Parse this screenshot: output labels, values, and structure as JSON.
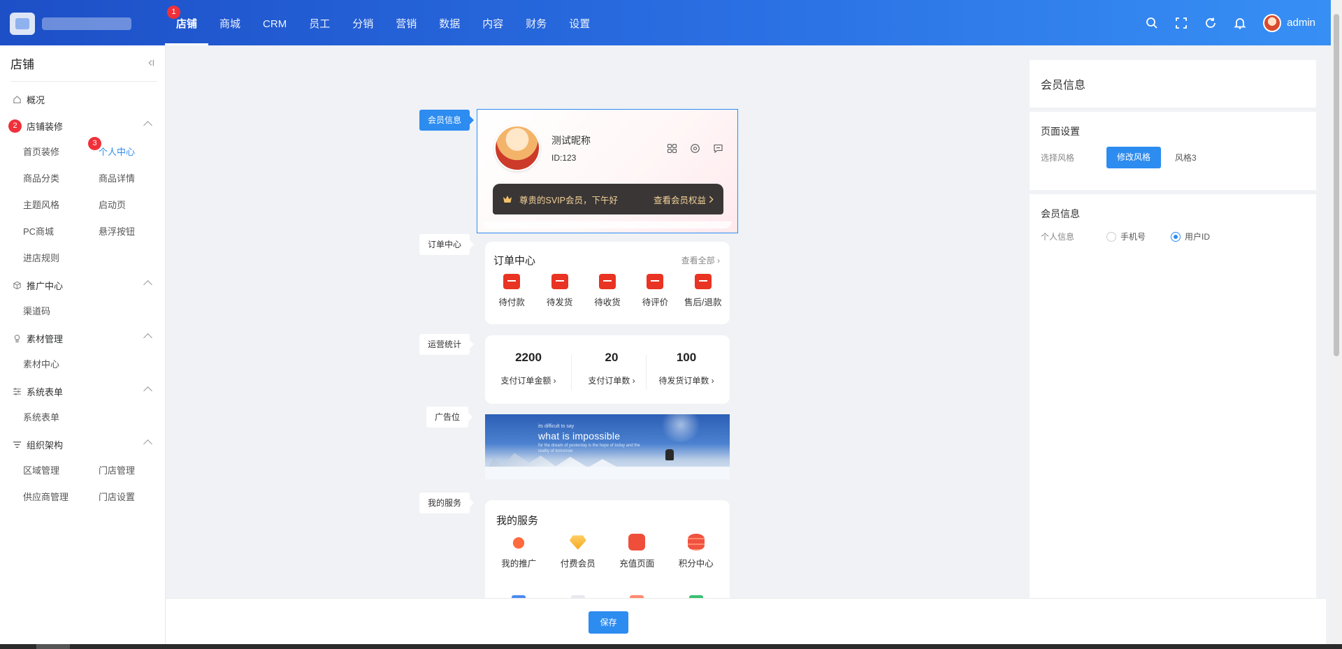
{
  "topbar": {
    "nav": [
      "店铺",
      "商城",
      "CRM",
      "员工",
      "分销",
      "营销",
      "数据",
      "内容",
      "财务",
      "设置"
    ],
    "active_index": 0,
    "badge": "1",
    "icons": [
      "search-icon",
      "fullscreen-icon",
      "refresh-icon",
      "bell-icon"
    ],
    "username": "admin"
  },
  "sidebar": {
    "title": "店铺",
    "overview": "概况",
    "groups": [
      {
        "label": "店铺装修",
        "badge": "2",
        "items": [
          "首页装修",
          "个人中心",
          "商品分类",
          "商品详情",
          "主题风格",
          "启动页",
          "PC商城",
          "悬浮按钮",
          "进店规则"
        ],
        "active_item": "个人中心",
        "active_badge": "3"
      },
      {
        "label": "推广中心",
        "items": [
          "渠道码"
        ]
      },
      {
        "label": "素材管理",
        "items": [
          "素材中心"
        ]
      },
      {
        "label": "系统表单",
        "items": [
          "系统表单"
        ]
      },
      {
        "label": "组织架构",
        "items": [
          "区域管理",
          "门店管理",
          "供应商管理",
          "门店设置"
        ]
      }
    ]
  },
  "preview": {
    "tags": [
      "会员信息",
      "订单中心",
      "运营统计",
      "广告位",
      "我的服务"
    ],
    "member": {
      "nickname": "测试昵称",
      "id": "ID:123",
      "vip_text": "尊贵的SVIP会员，下午好",
      "vip_link": "查看会员权益"
    },
    "order": {
      "title": "订单中心",
      "more": "查看全部",
      "items": [
        "待付款",
        "待发货",
        "待收货",
        "待评价",
        "售后/退款"
      ]
    },
    "stats": [
      {
        "value": "2200",
        "label": "支付订单金额"
      },
      {
        "value": "20",
        "label": "支付订单数"
      },
      {
        "value": "100",
        "label": "待发货订单数"
      }
    ],
    "banner": {
      "small": "its difficult to say",
      "big": "what is impossible",
      "sub": "for the dream of yesterday is the hope of today and the reality of tomorrow"
    },
    "service": {
      "title": "我的服务",
      "items": [
        "我的推广",
        "付费会员",
        "充值页面",
        "积分中心"
      ]
    }
  },
  "right_panel": {
    "header": "会员信息",
    "page_settings": {
      "title": "页面设置",
      "style_label": "选择风格",
      "button": "修改风格",
      "style_value": "风格3"
    },
    "member_info": {
      "title": "会员信息",
      "label": "个人信息",
      "options": [
        "手机号",
        "用户ID"
      ],
      "selected": "用户ID"
    }
  },
  "footer": {
    "save": "保存"
  },
  "colors": {
    "primary": "#2d8cf0",
    "accent_red": "#e93323",
    "badge": "#f0303a"
  }
}
